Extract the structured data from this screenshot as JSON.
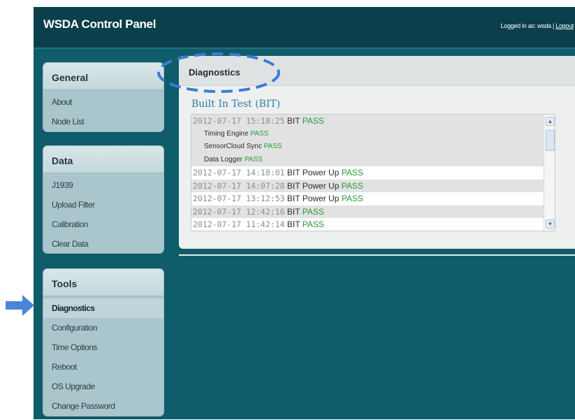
{
  "header": {
    "app_title": "WSDA Control Panel",
    "login_text": "Logged in as: wsda",
    "separator": " | ",
    "logout_label": "Logout"
  },
  "sidebar": {
    "general": {
      "title": "General",
      "items": [
        "About",
        "Node List"
      ]
    },
    "data": {
      "title": "Data",
      "items": [
        "J1939",
        "Upload Filter",
        "Calibration",
        "Clear Data"
      ]
    },
    "tools": {
      "title": "Tools",
      "items": [
        "Diagnostics",
        "Configuration",
        "Time Options",
        "Reboot",
        "OS Upgrade",
        "Change Password"
      ],
      "active": "Diagnostics"
    }
  },
  "main": {
    "title": "Diagnostics",
    "section_title": "Built In Test (BIT)",
    "log": [
      {
        "timestamp": "2012-07-17 15:18:25",
        "text": "BIT",
        "status": "PASS"
      },
      {
        "timestamp": "",
        "text": "Timing Engine",
        "status": "PASS"
      },
      {
        "timestamp": "",
        "text": "SensorCloud Sync",
        "status": "PASS"
      },
      {
        "timestamp": "",
        "text": "Data Logger",
        "status": "PASS"
      },
      {
        "timestamp": "2012-07-17 14:18:01",
        "text": "BIT Power Up",
        "status": "PASS"
      },
      {
        "timestamp": "2012-07-17 14:07:28",
        "text": "BIT Power Up",
        "status": "PASS"
      },
      {
        "timestamp": "2012-07-17 13:12:53",
        "text": "BIT Power Up",
        "status": "PASS"
      },
      {
        "timestamp": "2012-07-17 12:42:16",
        "text": "BIT",
        "status": "PASS"
      },
      {
        "timestamp": "2012-07-17 11:42:14",
        "text": "BIT",
        "status": "PASS"
      }
    ]
  },
  "colors": {
    "app_background": "#0f5c6b",
    "header_background": "#0b3f4c",
    "panel_background": "#a9c6cc",
    "pass_color": "#2b9a36",
    "section_title_color": "#2d7da1",
    "annotation_color": "#3a7bd5"
  },
  "icons": {
    "scroll_up": "▲",
    "scroll_down": "▼",
    "pointer_arrow": "arrow-right-icon",
    "highlight_ellipse": "dashed-ellipse-annotation"
  }
}
